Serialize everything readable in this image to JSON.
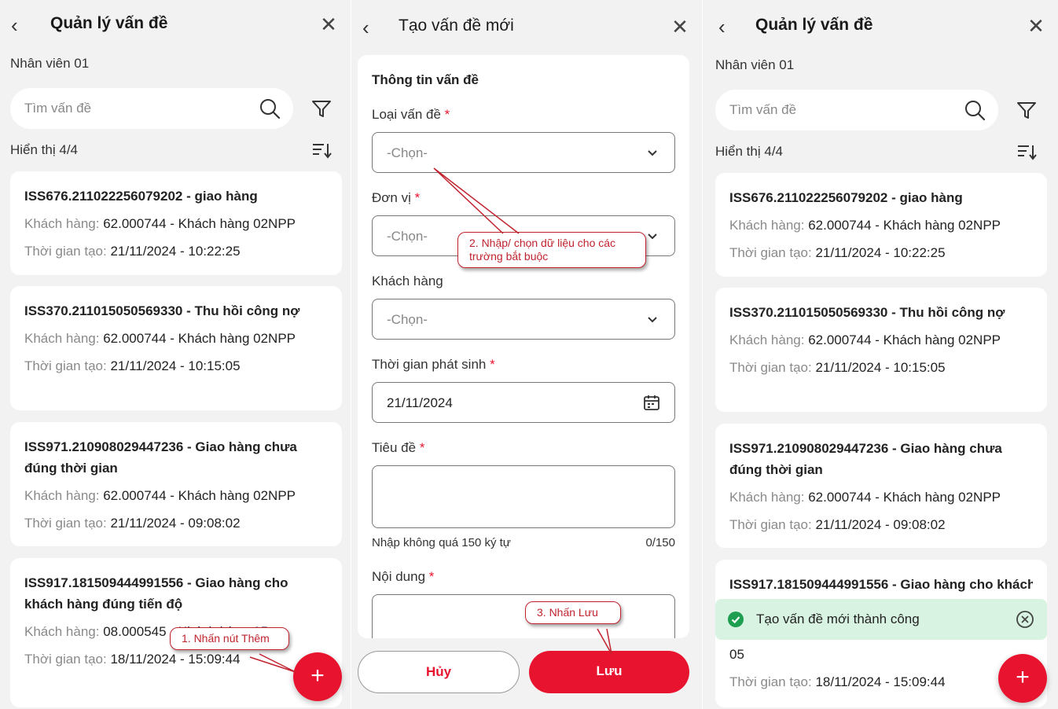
{
  "list_screen": {
    "title": "Quản lý vấn đề",
    "employee": "Nhân viên 01",
    "search_placeholder": "Tìm vấn đề",
    "count_text": "Hiển thị 4/4",
    "label_customer": "Khách hàng:",
    "label_created": "Thời gian tạo:",
    "fab_label": "+",
    "items": [
      {
        "title": "ISS676.211022256079202 - giao hàng",
        "customer": "62.000744 - Khách hàng 02NPP",
        "created": "21/11/2024 - 10:22:25"
      },
      {
        "title": "ISS370.211015050569330 - Thu  hồi công nợ",
        "customer": "62.000744 - Khách hàng 02NPP",
        "created": "21/11/2024 - 10:15:05"
      },
      {
        "title": "ISS971.210908029447236 - Giao hàng chưa đúng thời gian",
        "customer": "62.000744 - Khách hàng 02NPP",
        "created": "21/11/2024 - 09:08:02"
      },
      {
        "title": "ISS917.181509444991556 - Giao hàng cho khách hàng đúng tiến độ",
        "customer": "08.000545 - Khách hàng 05",
        "created": "18/11/2024 - 15:09:44"
      }
    ]
  },
  "create_screen": {
    "title": "Tạo vấn đề mới",
    "section": "Thông tin vấn đề",
    "required_mark": "*",
    "fields": {
      "issue_type": {
        "label": "Loại vấn đề",
        "value": "-Chọn-"
      },
      "unit": {
        "label": "Đơn vị",
        "value": "-Chọn-"
      },
      "customer": {
        "label": "Khách hàng",
        "value": "-Chọn-"
      },
      "occurred": {
        "label": "Thời gian phát sinh",
        "value": "21/11/2024"
      },
      "subject": {
        "label": "Tiêu đề",
        "hint": "Nhập không quá 150 ký tự",
        "counter": "0/150"
      },
      "content": {
        "label": "Nội dung"
      }
    },
    "cancel_label": "Hủy",
    "save_label": "Lưu"
  },
  "result_screen": {
    "toast": "Tạo vấn đề mới thành công",
    "last_item_customer_tail": "05"
  },
  "callouts": {
    "step1": "1. Nhấn nút Thêm",
    "step2": "2. Nhập/ chọn dữ liệu cho các trường bắt buộc",
    "step3": "3. Nhấn Lưu"
  },
  "colors": {
    "accent": "#e8142f",
    "toast_bg": "#d8f3e2",
    "toast_icon": "#1e9e4f"
  }
}
